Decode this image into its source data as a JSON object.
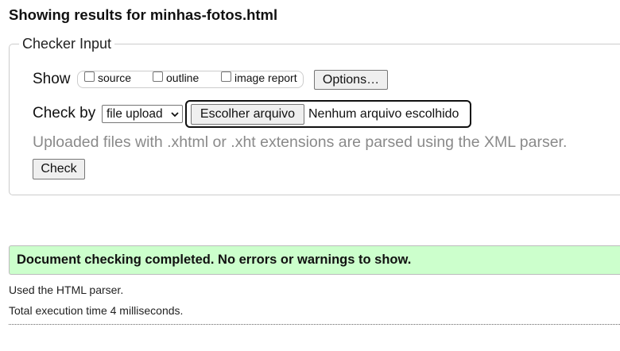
{
  "page": {
    "title": "Showing results for minhas-fotos.html"
  },
  "checker": {
    "legend": "Checker Input",
    "show_label": "Show",
    "show_options": [
      {
        "label": "source",
        "checked": false
      },
      {
        "label": "outline",
        "checked": false
      },
      {
        "label": "image report",
        "checked": false
      }
    ],
    "options_button": "Options…",
    "check_by_label": "Check by",
    "check_by_selected": "file upload",
    "file_button": "Escolher arquivo",
    "file_status": "Nenhum arquivo escolhido",
    "hint": "Uploaded files with .xhtml or .xht extensions are parsed using the XML parser.",
    "check_button": "Check"
  },
  "results": {
    "success_message": "Document checking completed. No errors or warnings to show.",
    "parser_info": "Used the HTML parser.",
    "execution_time": "Total execution time 4 milliseconds."
  },
  "colors": {
    "success_bg": "#ccffcc",
    "hint_text": "#8a8a8a",
    "border": "#cccccc"
  },
  "icons": {
    "select_chevron": "chevron-down-icon"
  }
}
